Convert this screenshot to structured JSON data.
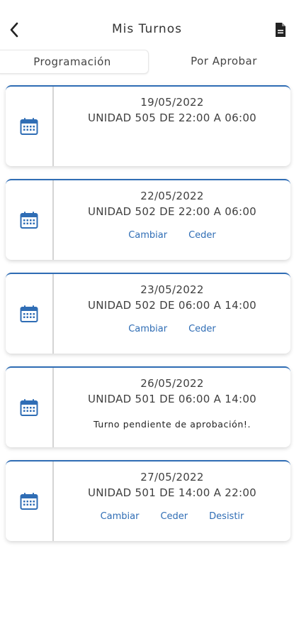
{
  "header": {
    "title": "Mis Turnos",
    "back_icon": "chevron-left-icon",
    "doc_icon": "document-icon"
  },
  "tabs": [
    {
      "label": "Programación",
      "active": true
    },
    {
      "label": "Por Aprobar",
      "active": false
    }
  ],
  "colors": {
    "accent": "#2f6db5",
    "text": "#3f3f3f",
    "divider": "#d4d4d4"
  },
  "shifts": [
    {
      "date": "19/05/2022",
      "description": "UNIDAD 505 DE 22:00 A 06:00",
      "icon": "calendar-icon"
    },
    {
      "date": "22/05/2022",
      "description": "UNIDAD 502 DE 22:00 A 06:00",
      "icon": "calendar-icon",
      "actions": [
        "Cambiar",
        "Ceder"
      ]
    },
    {
      "date": "23/05/2022",
      "description": "UNIDAD 502 DE 06:00 A 14:00",
      "icon": "calendar-icon",
      "actions": [
        "Cambiar",
        "Ceder"
      ]
    },
    {
      "date": "26/05/2022",
      "description": "UNIDAD 501 DE 06:00 A 14:00",
      "icon": "calendar-icon",
      "status": "Turno pendiente de aprobación!."
    },
    {
      "date": "27/05/2022",
      "description": "UNIDAD 501 DE 14:00 A 22:00",
      "icon": "calendar-icon",
      "actions": [
        "Cambiar",
        "Ceder",
        "Desistir"
      ]
    }
  ]
}
